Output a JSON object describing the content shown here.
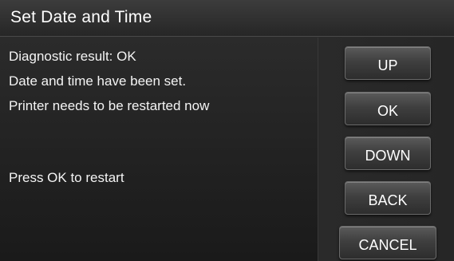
{
  "window": {
    "title": "Set Date and Time"
  },
  "messages": {
    "line1": "Diagnostic result: OK",
    "line2": "Date and time have been set.",
    "line3": "Printer needs to be restarted now",
    "line4": "Press OK to restart"
  },
  "buttons": {
    "up": "UP",
    "ok": "OK",
    "down": "DOWN",
    "back": "BACK",
    "cancel": "CANCEL"
  }
}
